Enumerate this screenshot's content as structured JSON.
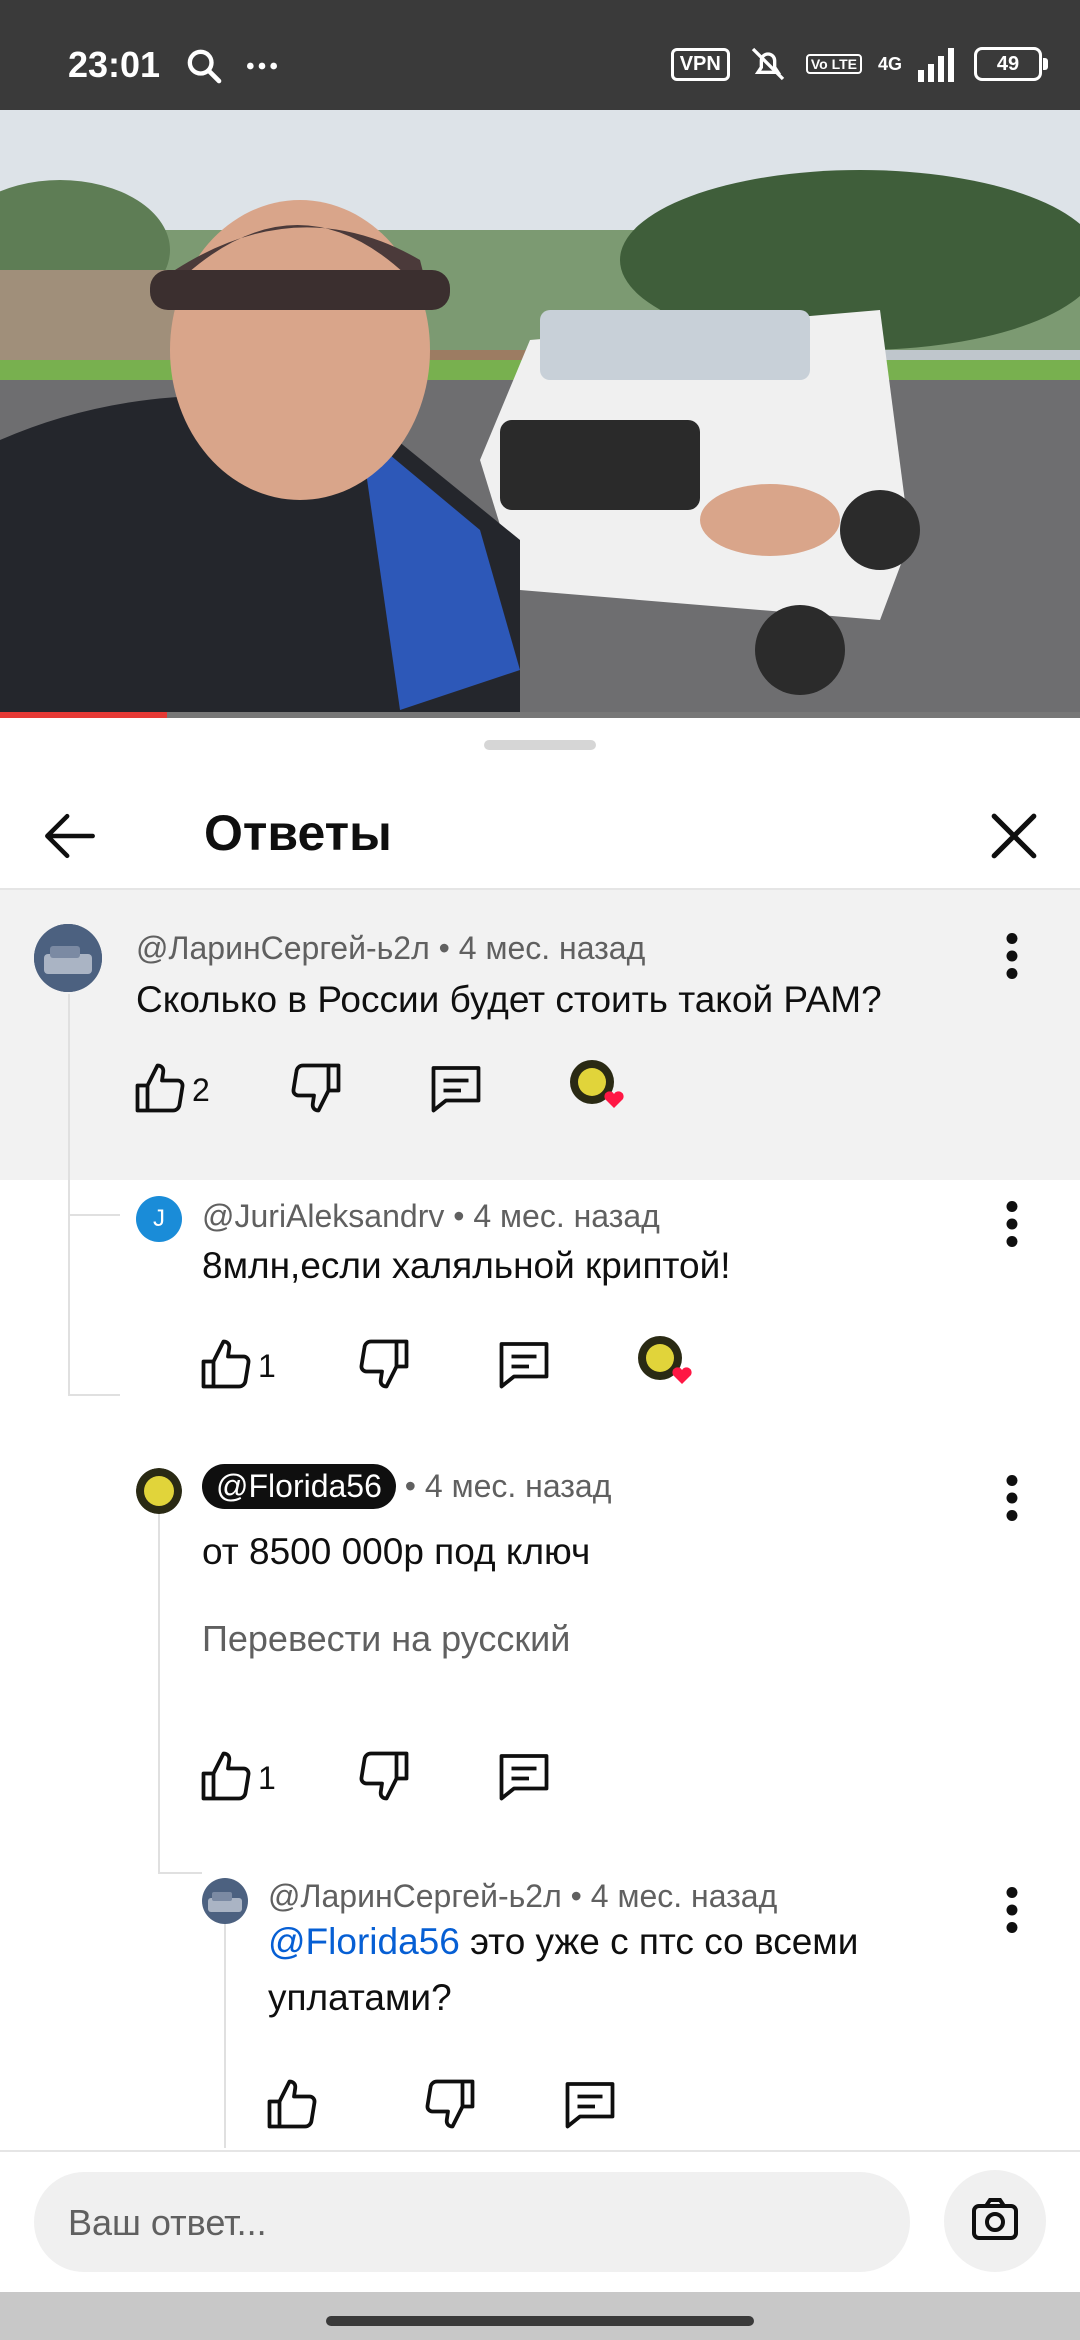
{
  "status_bar": {
    "time": "23:01",
    "vpn": "VPN",
    "lte": "Vo LTE",
    "network": "4G",
    "battery": "49"
  },
  "video": {
    "progress_fraction": 0.155,
    "icons": [
      "search-icon",
      "more-icon"
    ]
  },
  "header": {
    "title": "Ответы"
  },
  "comments": [
    {
      "author": "@ЛаринСергей-ь2л",
      "time": "• 4 мес. назад",
      "text": "Сколько в России будет стоить такой РАМ?",
      "likes": "2"
    },
    {
      "author": "@JuriAleksandrv",
      "avatar_letter": "J",
      "time": "• 4 мес. назад",
      "text": "8млн,если халяльной криптой!",
      "likes": "1"
    },
    {
      "author": "@Florida56",
      "time": "• 4 мес. назад",
      "text": "от 8500 000р под ключ",
      "translate": "Перевести на русский",
      "likes": "1"
    },
    {
      "author": "@ЛаринСергей-ь2л",
      "time": "• 4 мес. назад",
      "mention": "@Florida56",
      "text": " это уже с птс со всеми уплатами?"
    }
  ],
  "reply": {
    "placeholder": "Ваш ответ..."
  },
  "colors": {
    "accent_red": "#e53935",
    "mention_blue": "#065fd4",
    "parent_bg": "#f2f2f2"
  }
}
